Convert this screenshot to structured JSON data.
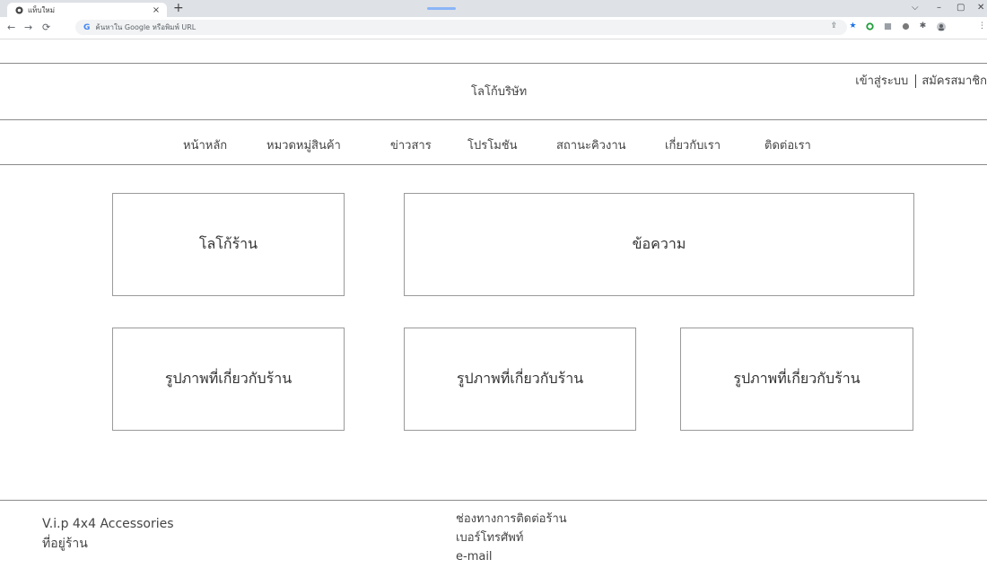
{
  "browser": {
    "tab_title": "แท็บใหม่",
    "tab_close": "×",
    "new_tab": "+",
    "omnibox_placeholder": "ค้นหาใน Google หรือพิมพ์ URL",
    "omnibox_engine": "G",
    "window_controls": [
      "⌵",
      "–",
      "▢",
      "✕"
    ]
  },
  "header": {
    "company_logo": "โลโก้บริษัท",
    "login": "เข้าสู่ระบบ",
    "register": "สมัครสมาชิก"
  },
  "nav": {
    "items": [
      "หน้าหลัก",
      "หมวดหมู่สินค้า",
      "ข่าวสาร",
      "โปรโมชัน",
      "สถานะคิวงาน",
      "เกี่ยวกับเรา",
      "ติดต่อเรา"
    ]
  },
  "content": {
    "shop_logo": "โลโก้ร้าน",
    "message": "ข้อความ",
    "shop_images": [
      "รูปภาพที่เกี่ยวกับร้าน",
      "รูปภาพที่เกี่ยวกับร้าน",
      "รูปภาพที่เกี่ยวกับร้าน"
    ]
  },
  "footer": {
    "shop_name": "V.i.p 4x4 Accessories",
    "address": "ที่อยู่ร้าน",
    "contact_channel": "ช่องทางการติดต่อร้าน",
    "phone": "เบอร์โทรศัพท์",
    "email": "e-mail"
  }
}
